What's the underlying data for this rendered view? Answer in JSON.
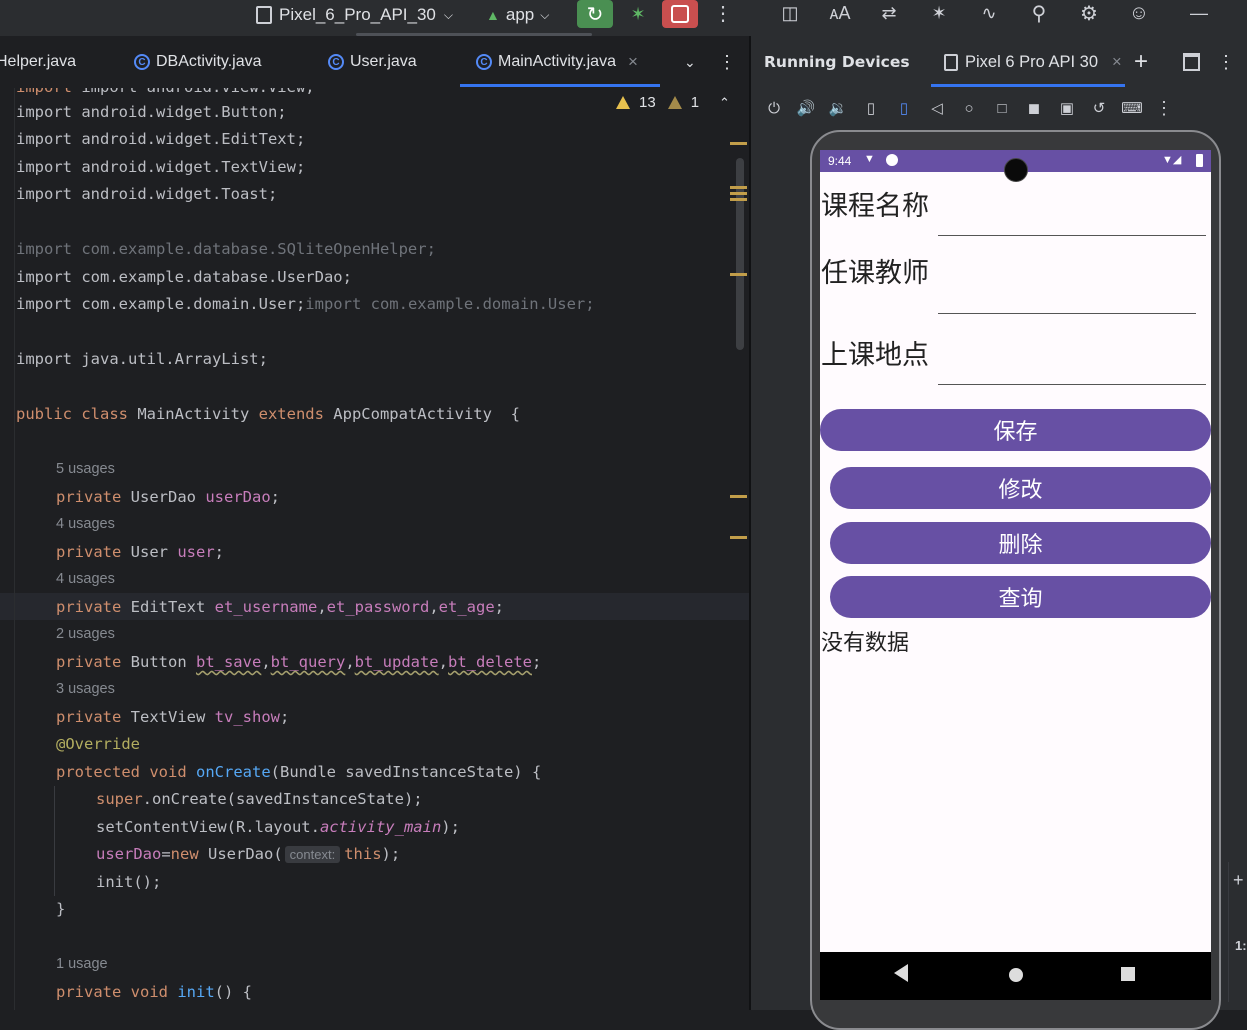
{
  "toolbar": {
    "device_selector": "Pixel_6_Pro_API_30",
    "run_config": "app",
    "accent_green": "#4a8f52",
    "accent_red": "#c94f4f"
  },
  "editor_tabs": [
    {
      "label": "Helper.java"
    },
    {
      "label": "DBActivity.java"
    },
    {
      "label": "User.java"
    },
    {
      "label": "MainActivity.java",
      "active": true,
      "close": "×"
    }
  ],
  "inspection": {
    "warnings": "13",
    "weak_warnings": "1"
  },
  "code": {
    "l0": "import android.view.View;",
    "l1": "import android.widget.Button;",
    "l2": "import android.widget.EditText;",
    "l3": "import android.widget.TextView;",
    "l4": "import android.widget.Toast;",
    "l6": "import com.example.database.SQliteOpenHelper;",
    "l7": "import com.example.database.UserDao;",
    "l8a": "import com.example.domain.User;",
    "l8b": "import com.example.domain.User;",
    "l10": "import java.util.ArrayList;",
    "usage_5": "5 usages",
    "usage_4a": "4 usages",
    "usage_4b": "4 usages",
    "usage_2": "2 usages",
    "usage_3": "3 usages",
    "usage_1": "1 usage",
    "hint_context": "context:"
  },
  "right_panel": {
    "title": "Running Devices",
    "device_tab": "Pixel 6 Pro API 30",
    "close": "×",
    "add": "+"
  },
  "phone": {
    "status_time": "9:44",
    "label_course": "课程名称",
    "label_teacher": "任课教师",
    "label_location": "上课地点",
    "btn_save": "保存",
    "btn_update": "修改",
    "btn_delete": "删除",
    "btn_query": "查询",
    "result_text": "没有数据",
    "status_color": "#6750a4"
  },
  "edge": {
    "text": "1:"
  }
}
